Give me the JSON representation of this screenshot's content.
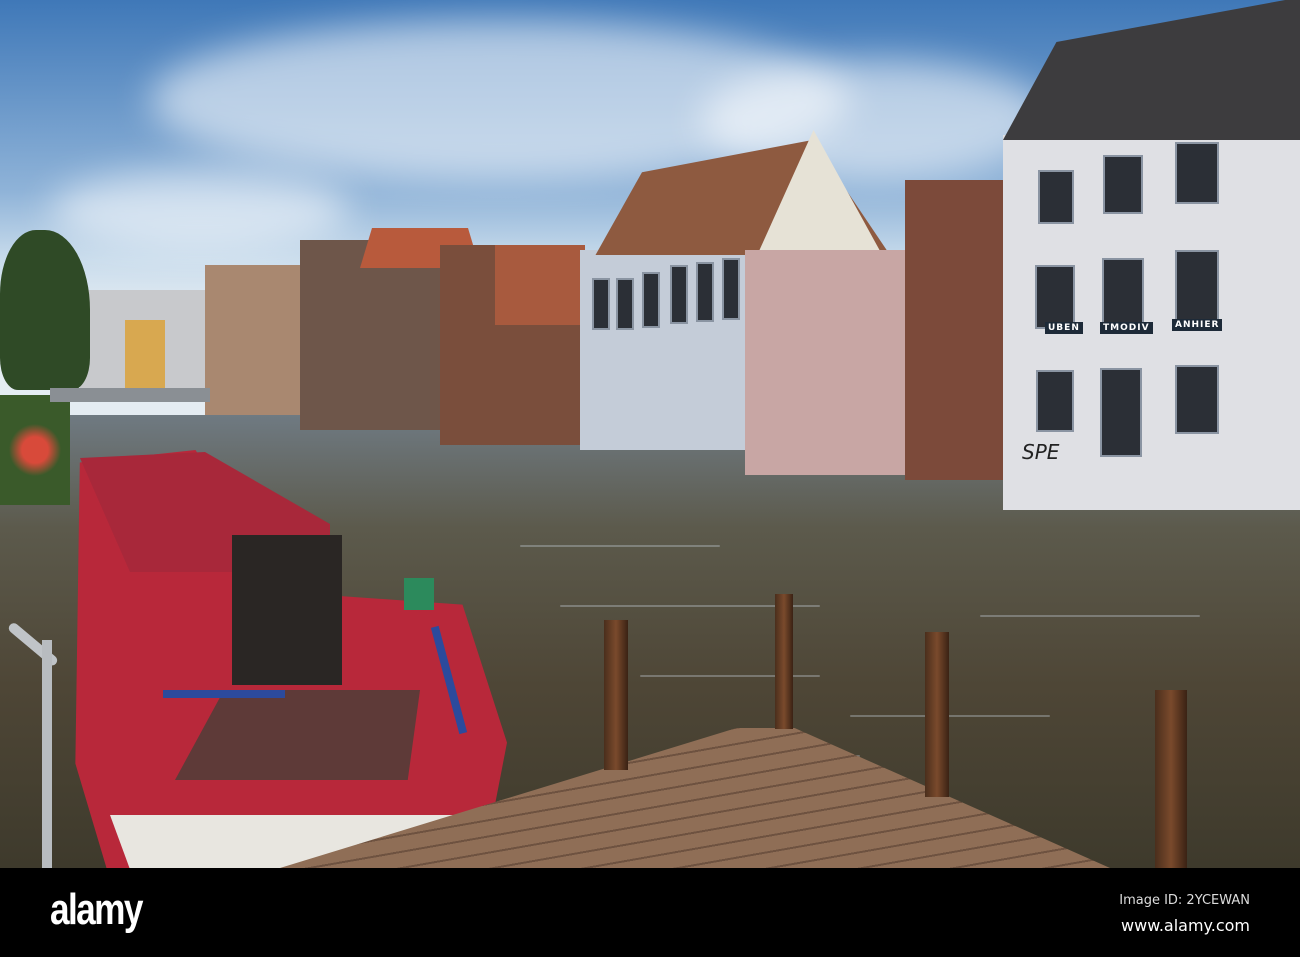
{
  "photo": {
    "subject": "Canal with red narrowboat and wooden pier",
    "signs": [
      "UBEN",
      "TMODIV",
      "ANHIER"
    ],
    "graffiti": "SPE"
  },
  "footer": {
    "logo": "alamy",
    "image_id": "Image ID: 2YCEWAN",
    "url": "www.alamy.com"
  },
  "colors": {
    "boat": "#b8283a",
    "water": "#4e4636",
    "sky": "#3f78b8",
    "footer": "#000000"
  }
}
